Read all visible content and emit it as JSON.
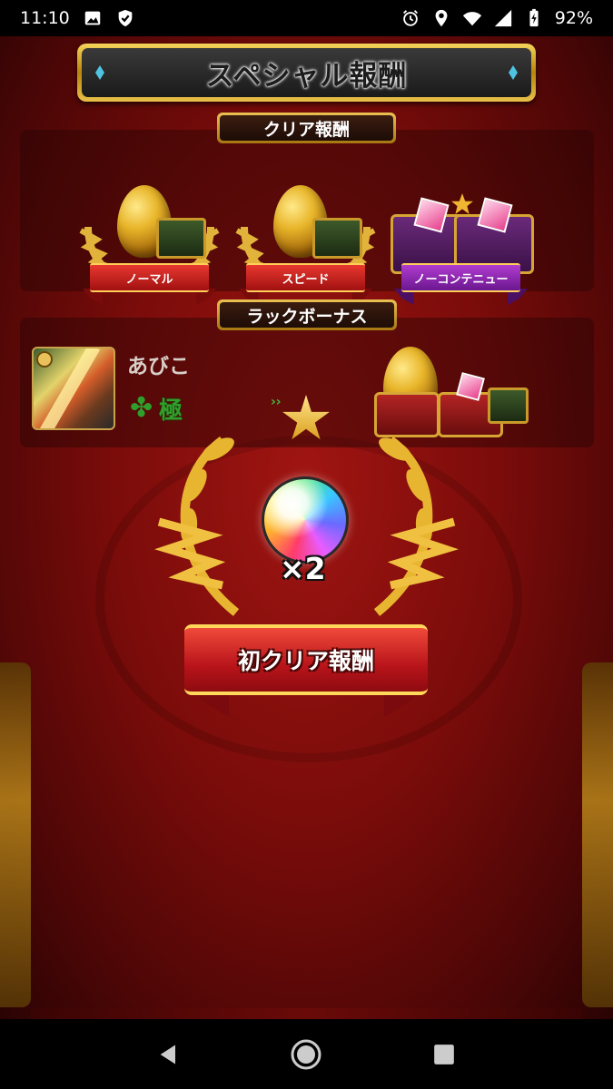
{
  "status_bar": {
    "time": "11:10",
    "battery": "92%",
    "icons": [
      "image-icon",
      "shield-icon",
      "alarm-icon",
      "location-icon",
      "wifi-icon",
      "signal-icon",
      "battery-icon"
    ]
  },
  "header": {
    "title": "スペシャル報酬"
  },
  "clear_reward": {
    "label": "クリア報酬",
    "items": [
      {
        "label": "ノーマル",
        "icon": "golden-egg-icon",
        "color": "#c8211b"
      },
      {
        "label": "スピード",
        "icon": "golden-egg-icon",
        "color": "#c8211b"
      },
      {
        "label": "ノーコンテニュー",
        "icon": "treasure-chest-icon",
        "color": "#8a22ad"
      }
    ]
  },
  "luck_bonus": {
    "label": "ラックボーナス",
    "player_name": "あびこ",
    "clover": "✤",
    "grade": "極"
  },
  "first_clear": {
    "multiplier": "×2",
    "label": "初クリア報酬",
    "icon": "rainbow-orb-icon"
  },
  "nav": {
    "icons": [
      "back-icon",
      "home-icon",
      "recents-icon"
    ]
  },
  "colors": {
    "background": "#8a0f0c",
    "gold": "#e2b33a",
    "luck_green": "#2f9e2a"
  }
}
